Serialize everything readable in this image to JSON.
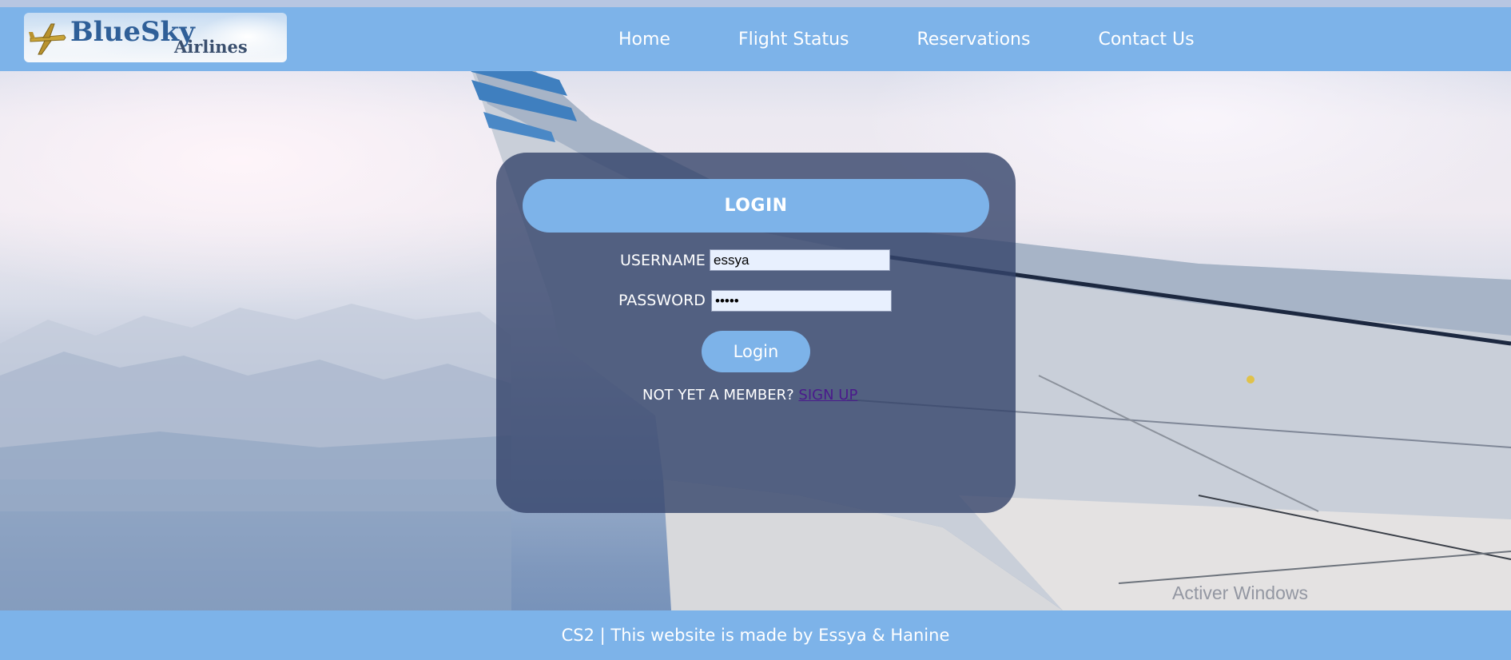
{
  "brand": {
    "name_main": "BlueSky",
    "name_sub": "Airlines"
  },
  "nav": {
    "items": [
      {
        "label": "Home"
      },
      {
        "label": "Flight Status"
      },
      {
        "label": "Reservations"
      },
      {
        "label": "Contact Us"
      }
    ]
  },
  "login": {
    "title": "LOGIN",
    "username_label": "USERNAME",
    "username_value": "essya",
    "password_label": "PASSWORD",
    "password_value": "•••••",
    "button_label": "Login",
    "member_prompt": "NOT YET A MEMBER?",
    "signup_link": "SIGN UP"
  },
  "footer": {
    "text": "CS2 | This website is made by Essya & Hanine"
  },
  "watermark": {
    "text": "Activer Windows"
  },
  "colors": {
    "header_blue": "#7db3e9",
    "card_overlay": "#34446a",
    "link_purple": "#4a1a8c"
  }
}
